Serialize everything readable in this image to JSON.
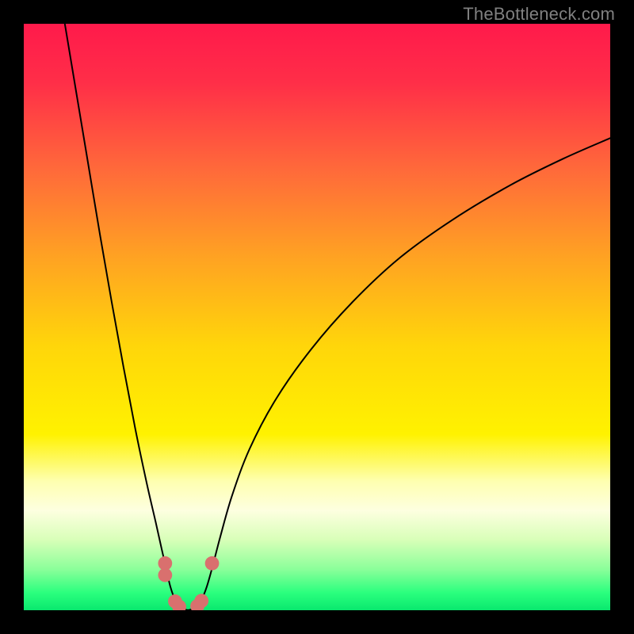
{
  "watermark": "TheBottleneck.com",
  "chart_data": {
    "type": "line",
    "title": "",
    "xlabel": "",
    "ylabel": "",
    "xlim": [
      0,
      100
    ],
    "ylim": [
      0,
      100
    ],
    "grid": false,
    "legend": false,
    "background_gradient": {
      "stops": [
        {
          "offset": 0.0,
          "color": "#ff1a4b"
        },
        {
          "offset": 0.1,
          "color": "#ff2e48"
        },
        {
          "offset": 0.25,
          "color": "#ff6a3a"
        },
        {
          "offset": 0.4,
          "color": "#ffa322"
        },
        {
          "offset": 0.55,
          "color": "#ffd60a"
        },
        {
          "offset": 0.7,
          "color": "#fff200"
        },
        {
          "offset": 0.78,
          "color": "#feffb0"
        },
        {
          "offset": 0.83,
          "color": "#fdffe0"
        },
        {
          "offset": 0.88,
          "color": "#d8ffb8"
        },
        {
          "offset": 0.93,
          "color": "#8bff9a"
        },
        {
          "offset": 0.97,
          "color": "#2bff7e"
        },
        {
          "offset": 1.0,
          "color": "#09e86e"
        }
      ]
    },
    "series": [
      {
        "name": "curve-left",
        "stroke": "#000000",
        "points": [
          {
            "x": 7.0,
            "y": 100.0
          },
          {
            "x": 9.0,
            "y": 88.0
          },
          {
            "x": 11.0,
            "y": 76.0
          },
          {
            "x": 13.0,
            "y": 64.0
          },
          {
            "x": 15.0,
            "y": 52.5
          },
          {
            "x": 17.0,
            "y": 41.5
          },
          {
            "x": 19.0,
            "y": 31.0
          },
          {
            "x": 21.0,
            "y": 21.5
          },
          {
            "x": 22.5,
            "y": 15.0
          },
          {
            "x": 23.5,
            "y": 10.5
          },
          {
            "x": 24.3,
            "y": 7.0
          },
          {
            "x": 25.0,
            "y": 4.0
          },
          {
            "x": 25.8,
            "y": 1.8
          },
          {
            "x": 26.8,
            "y": 0.4
          },
          {
            "x": 28.0,
            "y": 0.0
          }
        ]
      },
      {
        "name": "curve-right",
        "stroke": "#000000",
        "points": [
          {
            "x": 28.0,
            "y": 0.0
          },
          {
            "x": 29.2,
            "y": 0.4
          },
          {
            "x": 30.3,
            "y": 1.8
          },
          {
            "x": 31.2,
            "y": 4.0
          },
          {
            "x": 32.2,
            "y": 7.5
          },
          {
            "x": 33.5,
            "y": 12.5
          },
          {
            "x": 35.5,
            "y": 19.5
          },
          {
            "x": 38.5,
            "y": 27.5
          },
          {
            "x": 43.0,
            "y": 36.0
          },
          {
            "x": 49.0,
            "y": 44.5
          },
          {
            "x": 56.0,
            "y": 52.5
          },
          {
            "x": 64.0,
            "y": 60.0
          },
          {
            "x": 73.0,
            "y": 66.5
          },
          {
            "x": 83.0,
            "y": 72.5
          },
          {
            "x": 92.0,
            "y": 77.0
          },
          {
            "x": 100.0,
            "y": 80.5
          }
        ]
      }
    ],
    "markers": [
      {
        "x": 24.1,
        "y": 8.0,
        "r": 1.2,
        "fill": "#d9706e"
      },
      {
        "x": 24.1,
        "y": 6.0,
        "r": 1.2,
        "fill": "#d9706e"
      },
      {
        "x": 25.8,
        "y": 1.5,
        "r": 1.2,
        "fill": "#d9706e"
      },
      {
        "x": 26.5,
        "y": 0.6,
        "r": 1.2,
        "fill": "#d9706e"
      },
      {
        "x": 29.6,
        "y": 0.7,
        "r": 1.2,
        "fill": "#d9706e"
      },
      {
        "x": 30.3,
        "y": 1.6,
        "r": 1.2,
        "fill": "#d9706e"
      },
      {
        "x": 32.1,
        "y": 8.0,
        "r": 1.2,
        "fill": "#d9706e"
      }
    ]
  }
}
